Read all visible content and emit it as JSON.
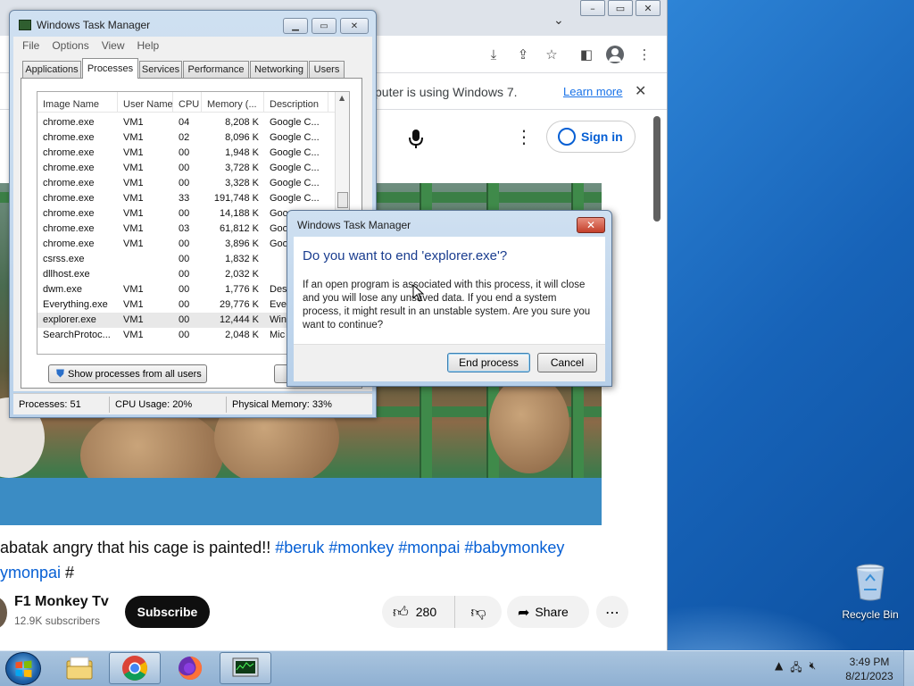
{
  "desktop": {
    "recycle_bin_label": "Recycle Bin"
  },
  "chrome": {
    "infobar_text": "puter is using Windows 7.",
    "infobar_link": "Learn more",
    "signin_label": "Sign in",
    "video_title_line1": "abatak angry that his cage is painted!! ",
    "video_title_tags1": "#beruk #monkey #monpai #babymonkey",
    "video_title_line2_tag": "ymonpai",
    "video_title_line2_rest": " #",
    "channel_name": "F1 Monkey Tv",
    "subscribers": "12.9K subscribers",
    "subscribe_label": "Subscribe",
    "like_count": "280",
    "share_label": "Share"
  },
  "task_manager": {
    "title": "Windows Task Manager",
    "menu": [
      "File",
      "Options",
      "View",
      "Help"
    ],
    "tabs": [
      "Applications",
      "Processes",
      "Services",
      "Performance",
      "Networking",
      "Users"
    ],
    "active_tab": "Processes",
    "columns": [
      "Image Name",
      "User Name",
      "CPU",
      "Memory (...",
      "Description"
    ],
    "rows": [
      {
        "name": "chrome.exe",
        "user": "VM1",
        "cpu": "04",
        "mem": "8,208 K",
        "desc": "Google C..."
      },
      {
        "name": "chrome.exe",
        "user": "VM1",
        "cpu": "02",
        "mem": "8,096 K",
        "desc": "Google C..."
      },
      {
        "name": "chrome.exe",
        "user": "VM1",
        "cpu": "00",
        "mem": "1,948 K",
        "desc": "Google C..."
      },
      {
        "name": "chrome.exe",
        "user": "VM1",
        "cpu": "00",
        "mem": "3,728 K",
        "desc": "Google C..."
      },
      {
        "name": "chrome.exe",
        "user": "VM1",
        "cpu": "00",
        "mem": "3,328 K",
        "desc": "Google C..."
      },
      {
        "name": "chrome.exe",
        "user": "VM1",
        "cpu": "33",
        "mem": "191,748 K",
        "desc": "Google C..."
      },
      {
        "name": "chrome.exe",
        "user": "VM1",
        "cpu": "00",
        "mem": "14,188 K",
        "desc": "Goo"
      },
      {
        "name": "chrome.exe",
        "user": "VM1",
        "cpu": "03",
        "mem": "61,812 K",
        "desc": "Goo"
      },
      {
        "name": "chrome.exe",
        "user": "VM1",
        "cpu": "00",
        "mem": "3,896 K",
        "desc": "Goo"
      },
      {
        "name": "csrss.exe",
        "user": "",
        "cpu": "00",
        "mem": "1,832 K",
        "desc": ""
      },
      {
        "name": "dllhost.exe",
        "user": "",
        "cpu": "00",
        "mem": "2,032 K",
        "desc": ""
      },
      {
        "name": "dwm.exe",
        "user": "VM1",
        "cpu": "00",
        "mem": "1,776 K",
        "desc": "Des"
      },
      {
        "name": "Everything.exe",
        "user": "VM1",
        "cpu": "00",
        "mem": "29,776 K",
        "desc": "Eve"
      },
      {
        "name": "explorer.exe",
        "user": "VM1",
        "cpu": "00",
        "mem": "12,444 K",
        "desc": "Win"
      },
      {
        "name": "SearchProtoc...",
        "user": "VM1",
        "cpu": "00",
        "mem": "2,048 K",
        "desc": "Mic"
      }
    ],
    "selected_row": 13,
    "show_all_label": "Show processes from all users",
    "end_button_partial": "E",
    "status": {
      "processes": "Processes: 51",
      "cpu": "CPU Usage: 20%",
      "memory": "Physical Memory: 33%"
    }
  },
  "dialog": {
    "title": "Windows Task Manager",
    "heading": "Do you want to end 'explorer.exe'?",
    "message": "If an open program is associated with this process, it will close and you will lose any unsaved data. If you end a system process, it might result in an unstable system. Are you sure you want to continue?",
    "end_process_label": "End process",
    "cancel_label": "Cancel"
  },
  "taskbar": {
    "time": "3:49 PM",
    "date": "8/21/2023"
  },
  "colors": {
    "link_blue": "#065fd4",
    "dialog_heading": "#1a3d8f",
    "close_red": "#c4402b"
  }
}
